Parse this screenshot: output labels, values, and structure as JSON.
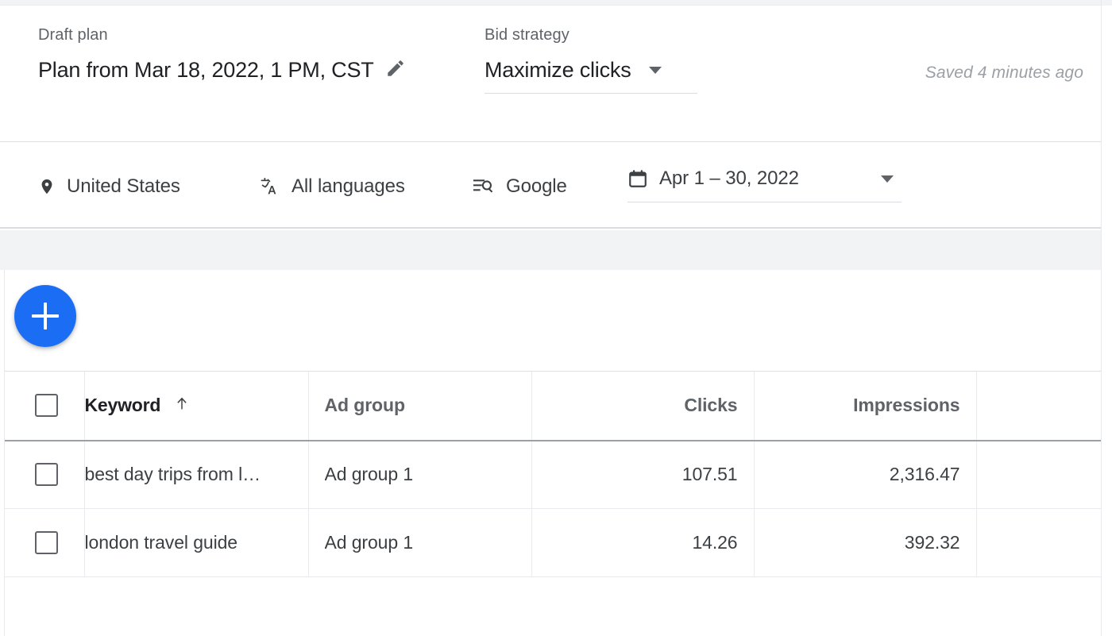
{
  "header": {
    "draft_label": "Draft plan",
    "plan_title": "Plan from Mar 18, 2022, 1 PM, CST",
    "edit_icon": "pencil-icon",
    "bid_label": "Bid strategy",
    "bid_value": "Maximize clicks",
    "bid_caret_icon": "chevron-down-icon",
    "saved_status": "Saved 4 minutes ago"
  },
  "filters": {
    "location": {
      "label": "United States",
      "icon": "location-pin-icon"
    },
    "language": {
      "label": "All languages",
      "icon": "translate-icon"
    },
    "network": {
      "label": "Google",
      "icon": "search-network-icon"
    },
    "date": {
      "label": "Apr 1 – 30, 2022",
      "icon": "calendar-icon",
      "caret_icon": "chevron-down-icon"
    }
  },
  "toolbar": {
    "add_label": "+",
    "add_icon": "plus-icon"
  },
  "table": {
    "columns": [
      {
        "key": "checkbox",
        "label": ""
      },
      {
        "key": "keyword",
        "label": "Keyword",
        "sorted": true,
        "sort_icon": "arrow-up-icon"
      },
      {
        "key": "ad_group",
        "label": "Ad group"
      },
      {
        "key": "clicks",
        "label": "Clicks"
      },
      {
        "key": "impressions",
        "label": "Impressions"
      },
      {
        "key": "extra",
        "label": ""
      }
    ],
    "rows": [
      {
        "keyword": "best day trips from l…",
        "ad_group": "Ad group 1",
        "clicks": "107.51",
        "impressions": "2,316.47",
        "extra": ""
      },
      {
        "keyword": "london travel guide",
        "ad_group": "Ad group 1",
        "clicks": "14.26",
        "impressions": "392.32",
        "extra": ""
      }
    ]
  },
  "colors": {
    "accent_blue": "#1b6ef3",
    "text_primary": "#202124",
    "text_secondary": "#5f6368",
    "text_muted": "#9aa0a6",
    "border": "#e8eaed",
    "surface_gray": "#f1f3f4"
  }
}
